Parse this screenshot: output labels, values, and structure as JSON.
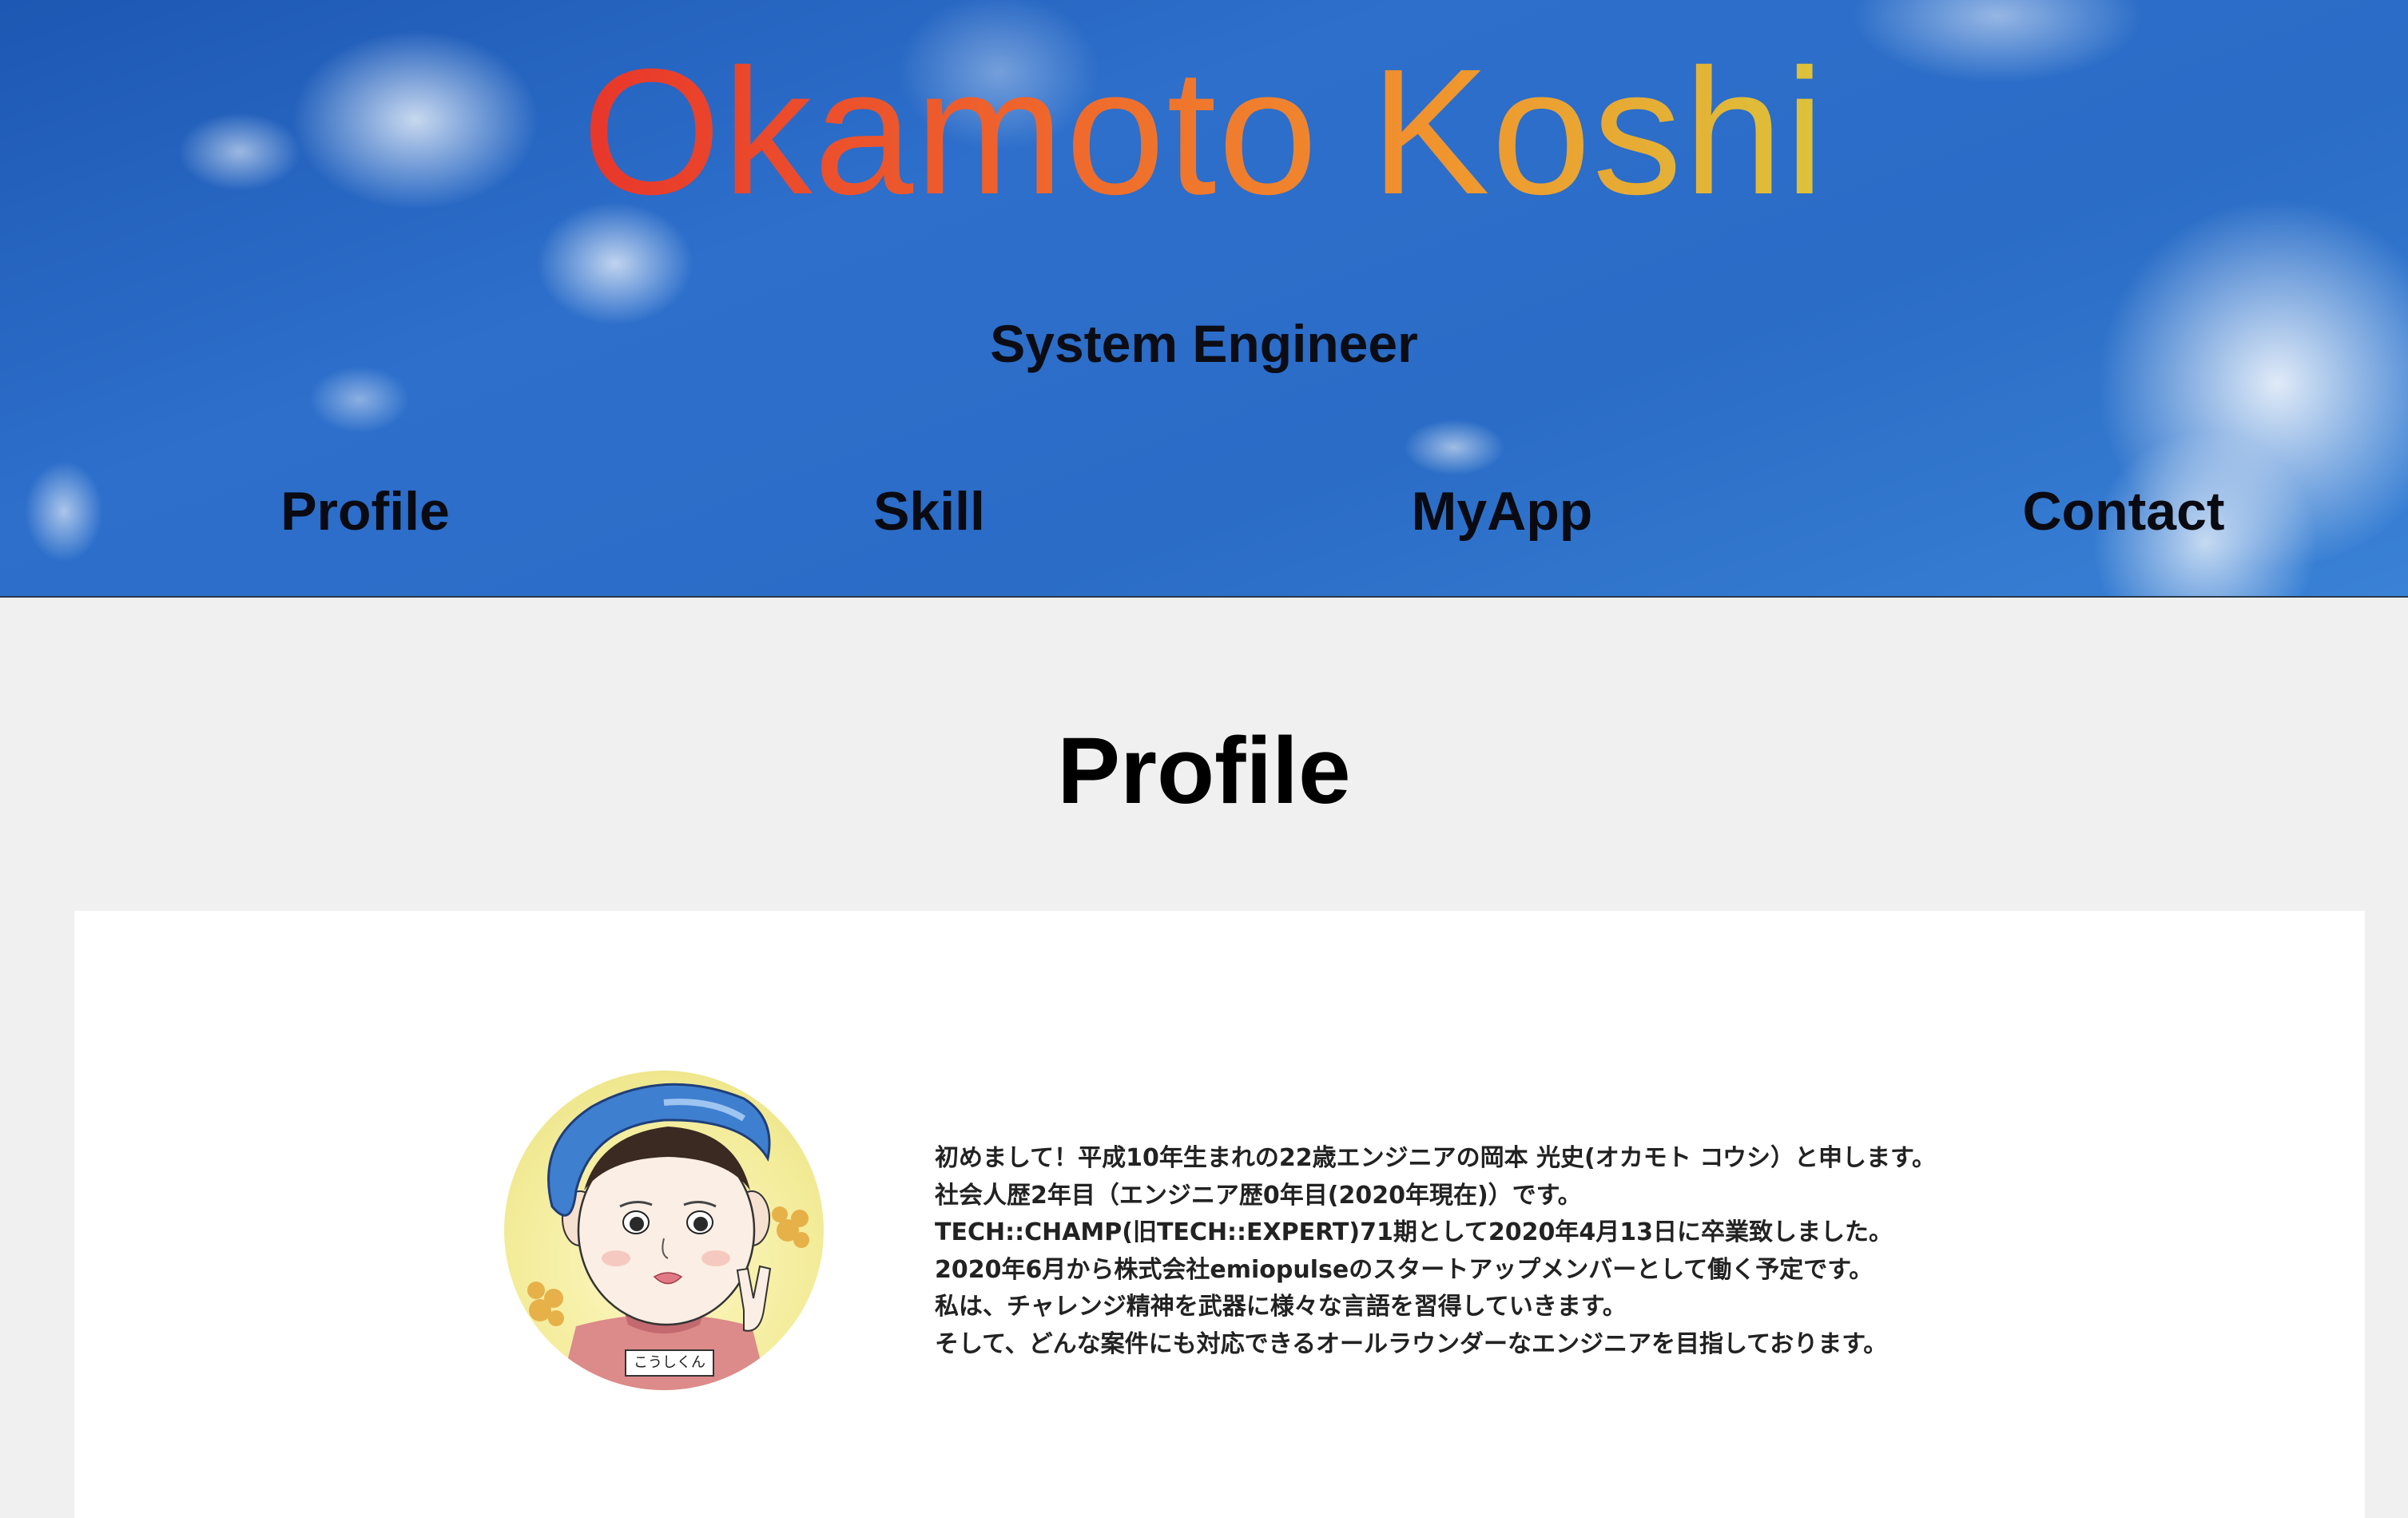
{
  "header": {
    "title": "Okamoto Koshi",
    "subtitle": "System Engineer",
    "nav": [
      {
        "label": "Profile"
      },
      {
        "label": "Skill"
      },
      {
        "label": "MyApp"
      },
      {
        "label": "Contact"
      }
    ]
  },
  "profile": {
    "heading": "Profile",
    "avatar_badge": "こうしくん",
    "bio_lines": [
      "初めまして！平成10年生まれの22歳エンジニアの岡本 光史(オカモト コウシ）と申します。",
      "社会人歴2年目（エンジニア歴0年目(2020年現在)）です。",
      "TECH::CHAMP(旧TECH::EXPERT)71期として2020年4月13日に卒業致しました。",
      "2020年6月から株式会社emiopulseのスタートアップメンバーとして働く予定です。",
      "私は、チャレンジ精神を武器に様々な言語を習得していきます。",
      "そして、どんな案件にも対応できるオールラウンダーなエンジニアを目指しております。"
    ]
  },
  "colors": {
    "title_gradient_start": "#e8362b",
    "title_gradient_end": "#dcc33a",
    "page_background": "#f0f0f0",
    "card_background": "#ffffff",
    "sky": "#2a6cc6"
  }
}
